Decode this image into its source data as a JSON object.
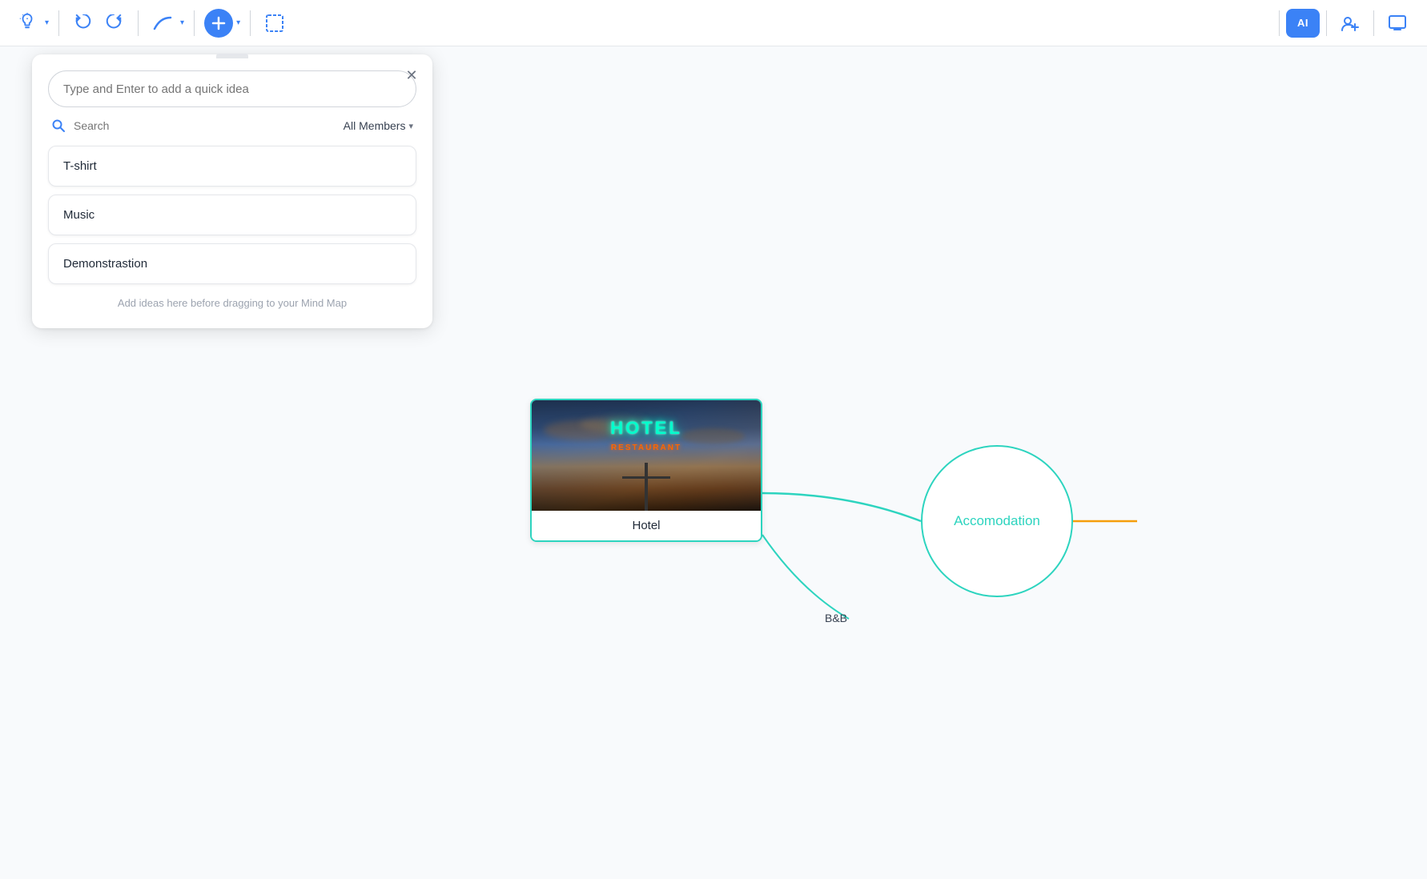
{
  "toolbar": {
    "bulb_icon": "💡",
    "undo_icon": "↩",
    "redo_icon": "↪",
    "curve_icon": "⌒",
    "add_icon": "+",
    "select_icon": "⬜",
    "ai_label": "AI",
    "add_user_icon": "👤+",
    "present_icon": "▶"
  },
  "panel": {
    "close_label": "×",
    "input_placeholder": "Type and Enter to add a quick idea",
    "search_placeholder": "Search",
    "filter_label": "All Members",
    "ideas": [
      {
        "text": "T-shirt"
      },
      {
        "text": "Music"
      },
      {
        "text": "Demonstrastion"
      }
    ],
    "hint_text": "Add ideas here before dragging to your Mind Map"
  },
  "mindmap": {
    "hotel_label": "Hotel",
    "hotel_sign": "HOTEL",
    "hotel_sub": "RESTAURANT",
    "accommodation_label": "Accomodation",
    "bnb_label": "B&B",
    "connection_color": "#2dd4bf"
  }
}
